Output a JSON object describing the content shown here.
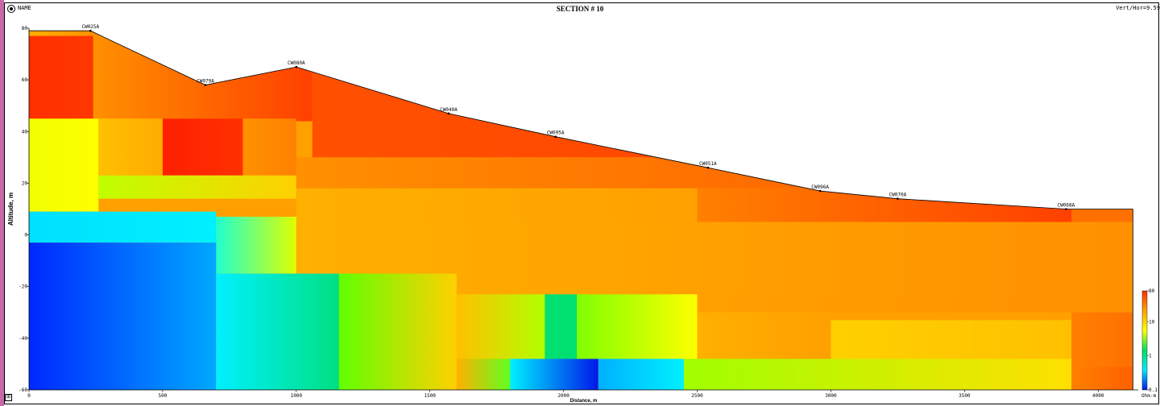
{
  "header": {
    "name_label": "NAME",
    "title": "SECTION # 10",
    "vert_hor": "Vert/Hor=9.59"
  },
  "nav": {
    "toggle_icon": "expand-toggle-icon",
    "glyph": "⊞"
  },
  "colors": {
    "frame": "#000000",
    "sidebar_accent": "#c86aa8"
  },
  "chart_data": {
    "type": "heatmap",
    "title": "SECTION # 10",
    "xlabel": "Distance, m",
    "ylabel": "Altitude, m",
    "xlim": [
      0,
      4150
    ],
    "ylim": [
      -60,
      80
    ],
    "x_ticks": [
      0,
      500,
      1000,
      1500,
      2000,
      2500,
      3000,
      3500,
      4000
    ],
    "y_ticks": [
      -60,
      -40,
      -20,
      0,
      20,
      40,
      60,
      80
    ],
    "color_scale": {
      "unit": "Ohm-m",
      "tick_labels": [
        "0.1",
        "1",
        "10",
        "80"
      ],
      "colors": [
        "#0018e8",
        "#00e8ff",
        "#00e060",
        "#ffff00",
        "#ffa000",
        "#ff3000"
      ]
    },
    "stations": [
      {
        "name": "CW025A",
        "x": 230,
        "y": 79
      },
      {
        "name": "CW079A",
        "x": 660,
        "y": 58
      },
      {
        "name": "CW080A",
        "x": 1000,
        "y": 65
      },
      {
        "name": "CW040A",
        "x": 1570,
        "y": 47
      },
      {
        "name": "CW095A",
        "x": 1970,
        "y": 38
      },
      {
        "name": "CW051A",
        "x": 2540,
        "y": 26
      },
      {
        "name": "CW096A",
        "x": 2960,
        "y": 17
      },
      {
        "name": "CW070A",
        "x": 3250,
        "y": 14
      },
      {
        "name": "CW068A",
        "x": 3880,
        "y": 10
      }
    ],
    "surface": [
      {
        "x": 0,
        "y": 79
      },
      {
        "x": 230,
        "y": 79
      },
      {
        "x": 660,
        "y": 58
      },
      {
        "x": 1000,
        "y": 65
      },
      {
        "x": 1570,
        "y": 47
      },
      {
        "x": 1970,
        "y": 38
      },
      {
        "x": 2540,
        "y": 26
      },
      {
        "x": 2960,
        "y": 17
      },
      {
        "x": 3250,
        "y": 14
      },
      {
        "x": 3880,
        "y": 10
      },
      {
        "x": 4130,
        "y": 10
      }
    ],
    "layers": [
      {
        "x0": 0,
        "x1": 240,
        "y0": 77,
        "y1": 80,
        "c0": "#ffb000",
        "c1": "#ff9000"
      },
      {
        "x0": 0,
        "x1": 1060,
        "y0": 44,
        "y1": 77,
        "c0": "#ff3000",
        "c1": "#ff5000"
      },
      {
        "x0": 240,
        "x1": 1060,
        "y0": 44,
        "y1": 80,
        "c0": "#ff9000",
        "c1": "#ff4000"
      },
      {
        "x0": 1060,
        "x1": 4130,
        "y0": 30,
        "y1": 66,
        "c0": "#ff5000",
        "c1": "#ff4000"
      },
      {
        "x0": 0,
        "x1": 260,
        "y0": 9,
        "y1": 45,
        "c0": "#f0ff00",
        "c1": "#ffff00"
      },
      {
        "x0": 260,
        "x1": 1000,
        "y0": 23,
        "y1": 45,
        "c0": "#ffc000",
        "c1": "#ff8000"
      },
      {
        "x0": 500,
        "x1": 800,
        "y0": 23,
        "y1": 45,
        "c0": "#ff2000",
        "c1": "#ff3000"
      },
      {
        "x0": 260,
        "x1": 1000,
        "y0": 14,
        "y1": 23,
        "c0": "#c0ff00",
        "c1": "#ffd000"
      },
      {
        "x0": 1000,
        "x1": 4130,
        "y0": 18,
        "y1": 30,
        "c0": "#ff9000",
        "c1": "#ff5000"
      },
      {
        "x0": 1000,
        "x1": 2500,
        "y0": 5,
        "y1": 18,
        "c0": "#ffb000",
        "c1": "#ffa000"
      },
      {
        "x0": 2500,
        "x1": 3900,
        "y0": -2,
        "y1": 18,
        "c0": "#ff8000",
        "c1": "#ff4000"
      },
      {
        "x0": 3900,
        "x1": 4130,
        "y0": 0,
        "y1": 18,
        "c0": "#ff7000",
        "c1": "#ff7000"
      },
      {
        "x0": 0,
        "x1": 700,
        "y0": -3,
        "y1": 9,
        "c0": "#00e0ff",
        "c1": "#00f0ff"
      },
      {
        "x0": 700,
        "x1": 1000,
        "y0": -15,
        "y1": 7,
        "c0": "#20ffd0",
        "c1": "#e0ff00"
      },
      {
        "x0": 1000,
        "x1": 4130,
        "y0": -30,
        "y1": 5,
        "c0": "#ffb000",
        "c1": "#ff9000"
      },
      {
        "x0": 0,
        "x1": 700,
        "y0": -60,
        "y1": -3,
        "c0": "#0028ff",
        "c1": "#00a8ff"
      },
      {
        "x0": 700,
        "x1": 1160,
        "y0": -60,
        "y1": -15,
        "c0": "#00f0ff",
        "c1": "#00e080"
      },
      {
        "x0": 1160,
        "x1": 1600,
        "y0": -60,
        "y1": -15,
        "c0": "#60ff00",
        "c1": "#ffd000"
      },
      {
        "x0": 1600,
        "x1": 1930,
        "y0": -48,
        "y1": -23,
        "c0": "#ffc000",
        "c1": "#b0ff00"
      },
      {
        "x0": 1930,
        "x1": 2050,
        "y0": -48,
        "y1": -23,
        "c0": "#00e070",
        "c1": "#00e070"
      },
      {
        "x0": 2050,
        "x1": 2500,
        "y0": -48,
        "y1": -23,
        "c0": "#80ff00",
        "c1": "#ffff00"
      },
      {
        "x0": 2500,
        "x1": 4130,
        "y0": -30,
        "y1": -23,
        "c0": "#ffa000",
        "c1": "#ff9000"
      },
      {
        "x0": 2500,
        "x1": 3000,
        "y0": -48,
        "y1": -30,
        "c0": "#ffb000",
        "c1": "#ffa000"
      },
      {
        "x0": 3000,
        "x1": 3900,
        "y0": -48,
        "y1": -33,
        "c0": "#ffd000",
        "c1": "#ffc000"
      },
      {
        "x0": 3900,
        "x1": 4130,
        "y0": -51,
        "y1": -30,
        "c0": "#ff8000",
        "c1": "#ff7000"
      },
      {
        "x0": 1600,
        "x1": 1800,
        "y0": -60,
        "y1": -48,
        "c0": "#ffb000",
        "c1": "#60ff20"
      },
      {
        "x0": 1800,
        "x1": 2130,
        "y0": -60,
        "y1": -48,
        "c0": "#00f0ff",
        "c1": "#0018e8"
      },
      {
        "x0": 2130,
        "x1": 2450,
        "y0": -60,
        "y1": -48,
        "c0": "#00b0ff",
        "c1": "#00f0ff"
      },
      {
        "x0": 2450,
        "x1": 3900,
        "y0": -60,
        "y1": -48,
        "c0": "#a0ff00",
        "c1": "#ffe000"
      },
      {
        "x0": 3900,
        "x1": 4130,
        "y0": -60,
        "y1": -51,
        "c0": "#ff8000",
        "c1": "#ff6000"
      }
    ]
  }
}
